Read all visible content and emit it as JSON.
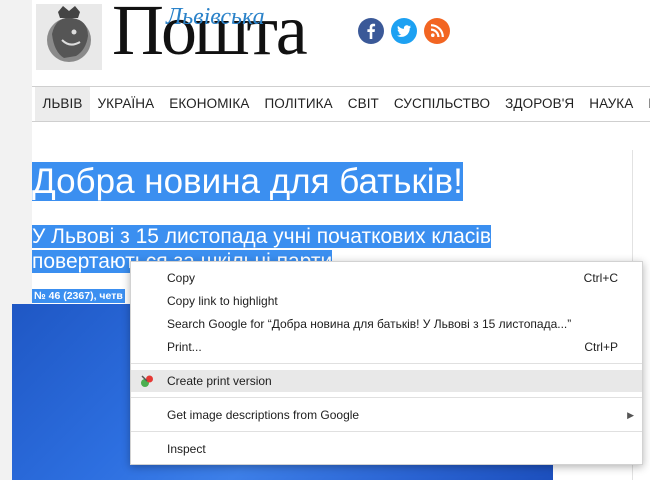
{
  "header": {
    "brand_small": "Львівська",
    "brand_big": "Пошта",
    "social": [
      "facebook-icon",
      "twitter-icon",
      "rss-icon"
    ],
    "colors": {
      "facebook": "#3b5998",
      "twitter": "#1da1f2",
      "rss": "#f26522",
      "selection": "#3b8ff0"
    }
  },
  "nav": {
    "items": [
      "ЛЬВІВ",
      "УКРАЇНА",
      "ЕКОНОМІКА",
      "ПОЛІТИКА",
      "СВІТ",
      "СУСПІЛЬСТВО",
      "ЗДОРОВ'Я",
      "НАУКА",
      "КУЛ"
    ]
  },
  "article": {
    "headline": "Добра новина для батьків!",
    "subhead": "У Львові з 15 листопада учні початкових класів повертаються за шкільні парти",
    "meta": "№ 46 (2367), четв"
  },
  "context_menu": {
    "copy": {
      "label": "Copy",
      "shortcut": "Ctrl+C"
    },
    "copy_link": {
      "label": "Copy link to highlight"
    },
    "search": {
      "label": "Search Google for “Добра новина для батьків! У Львові з 15 листопада...”"
    },
    "print": {
      "label": "Print...",
      "shortcut": "Ctrl+P"
    },
    "print_version": {
      "label": "Create print version",
      "icon": "print-friendly-icon"
    },
    "image_desc": {
      "label": "Get image descriptions from Google"
    },
    "inspect": {
      "label": "Inspect"
    }
  }
}
